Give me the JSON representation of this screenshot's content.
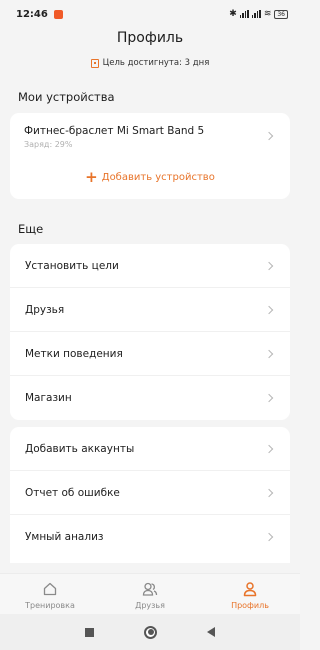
{
  "status_bar": {
    "time": "12:46",
    "battery": "36"
  },
  "header": {
    "title": "Профиль",
    "goal_text": "Цель достигнута: 3 дня"
  },
  "devices": {
    "section_title": "Мои устройства",
    "device_name": "Фитнес-браслет Mi Smart Band 5",
    "device_charge": "Заряд: 29%",
    "add_label": "Добавить устройство"
  },
  "more": {
    "section_title": "Еще",
    "items": [
      {
        "label": "Установить цели"
      },
      {
        "label": "Друзья"
      },
      {
        "label": "Метки поведения"
      },
      {
        "label": "Магазин"
      }
    ]
  },
  "more2": {
    "items": [
      {
        "label": "Добавить аккаунты"
      },
      {
        "label": "Отчет об ошибке"
      },
      {
        "label": "Умный анализ"
      }
    ]
  },
  "bottom_nav": {
    "tabs": [
      {
        "label": "Тренировка",
        "icon": "home-icon"
      },
      {
        "label": "Друзья",
        "icon": "friends-icon"
      },
      {
        "label": "Профиль",
        "icon": "profile-icon",
        "active": true
      }
    ]
  },
  "colors": {
    "accent": "#e8742a",
    "background": "#f4f4f4"
  }
}
